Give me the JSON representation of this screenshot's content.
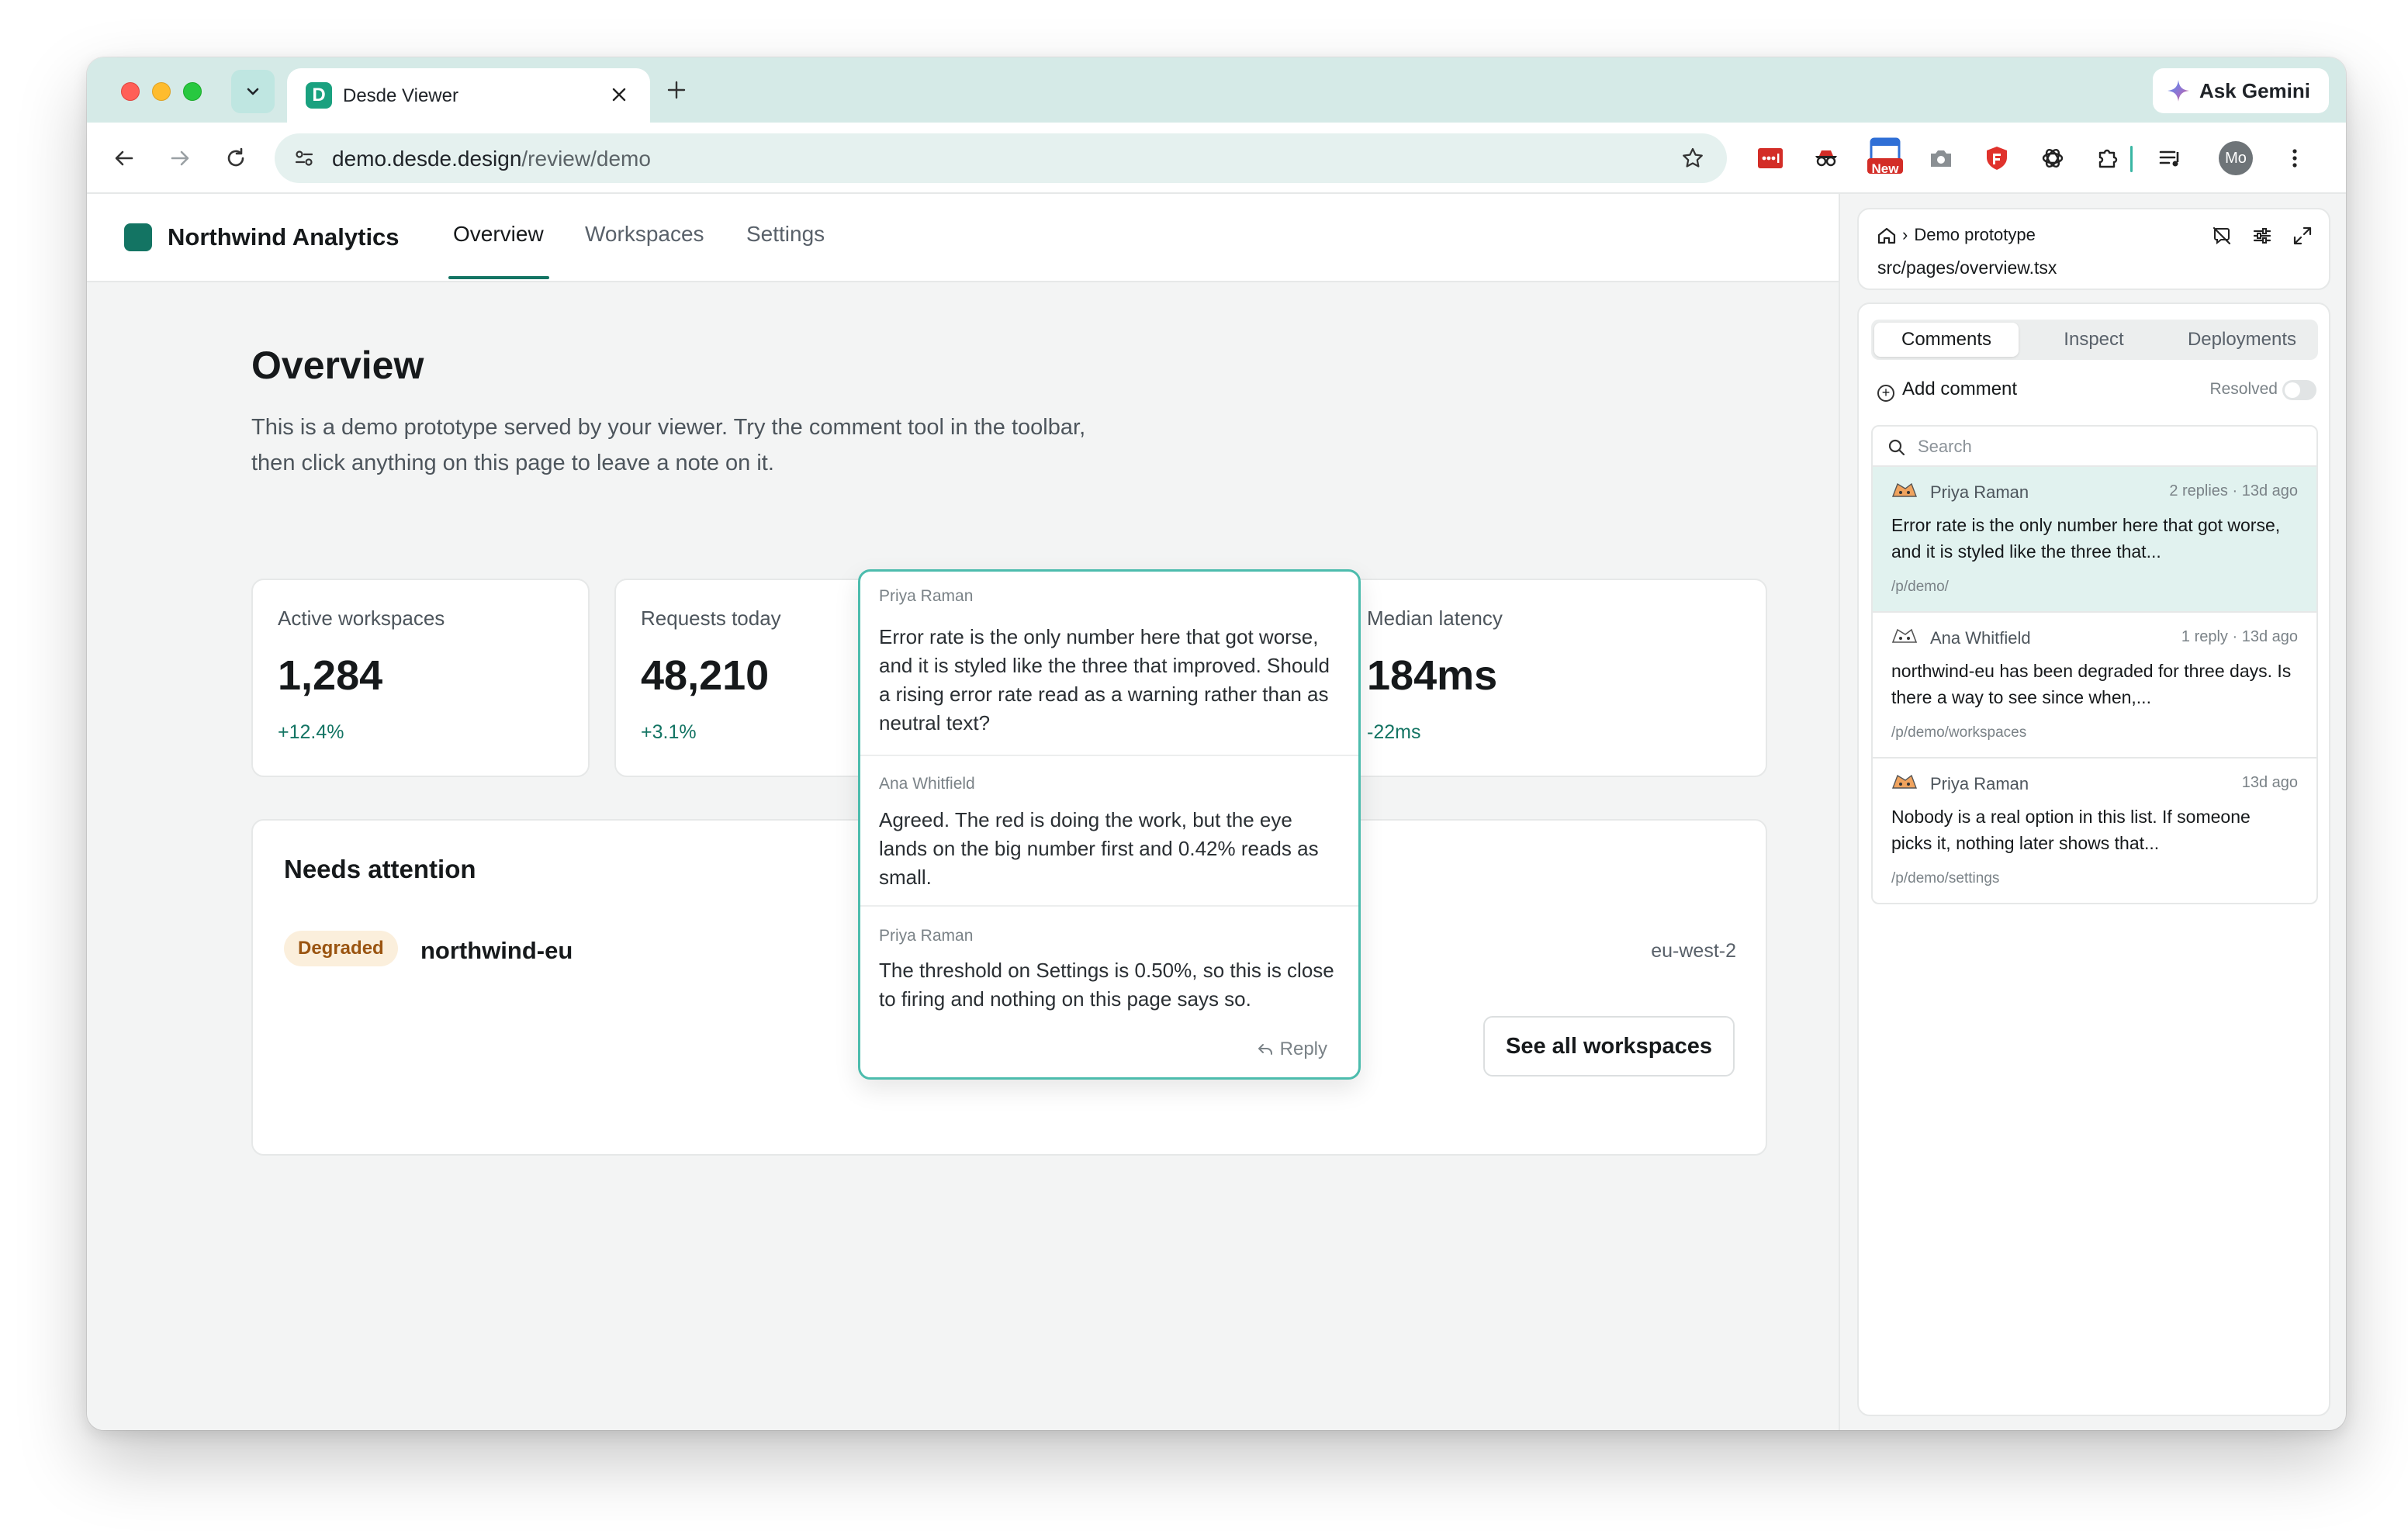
{
  "browser": {
    "tab_title": "Desde Viewer",
    "tab_favicon_letter": "D",
    "ask_gemini": "Ask Gemini",
    "url_host": "demo.desde.design",
    "url_path": "/review/demo",
    "ext_new_badge": "New",
    "profile_initials": "Mo"
  },
  "app": {
    "brand": "Northwind Analytics",
    "nav": [
      "Overview",
      "Workspaces",
      "Settings"
    ],
    "active_nav": "Overview"
  },
  "overview": {
    "title": "Overview",
    "lede": "This is a demo prototype served by your viewer. Try the comment tool in the toolbar, then click anything on this page to leave a note on it.",
    "stats": [
      {
        "label": "Active workspaces",
        "value": "1,284",
        "delta": "+12.4%"
      },
      {
        "label": "Requests today",
        "value": "48,210",
        "delta": "+3.1%"
      },
      {
        "label": "Median latency",
        "value": "184ms",
        "delta": "-22ms"
      }
    ],
    "attention": {
      "title": "Needs attention",
      "badge": "Degraded",
      "workspace": "northwind-eu",
      "region": "eu-west-2",
      "button": "See all workspaces"
    }
  },
  "popover": {
    "messages": [
      {
        "author": "Priya Raman",
        "body": "Error rate is the only number here that got worse, and it is styled like the three that improved. Should a rising error rate read as a warning rather than as neutral text?"
      },
      {
        "author": "Ana Whitfield",
        "body": "Agreed. The red is doing the work, but the eye lands on the big number first and 0.42% reads as small."
      },
      {
        "author": "Priya Raman",
        "body": "The threshold on Settings is 0.50%, so this is close to firing and nothing on this page says so."
      }
    ],
    "reply": "Reply"
  },
  "panel": {
    "breadcrumb": "Demo prototype",
    "file": "src/pages/overview.tsx",
    "tabs": [
      "Comments",
      "Inspect",
      "Deployments"
    ],
    "active_tab": "Comments",
    "add_comment": "Add comment",
    "resolved": "Resolved",
    "search_placeholder": "Search",
    "comments": [
      {
        "author": "Priya Raman",
        "meta": "2 replies · 13d ago",
        "body": "Error rate is the only number here that got worse, and it is styled like the three that...",
        "path": "/p/demo/",
        "selected": true
      },
      {
        "author": "Ana Whitfield",
        "meta": "1 reply · 13d ago",
        "body": "northwind-eu has been degraded for three days. Is there a way to see since when,...",
        "path": "/p/demo/workspaces",
        "selected": false
      },
      {
        "author": "Priya Raman",
        "meta": "13d ago",
        "body": "Nobody is a real option in this list. If someone picks it, nothing later shows that...",
        "path": "/p/demo/settings",
        "selected": false
      }
    ]
  },
  "colors": {
    "accent": "#137463",
    "popover_border": "#4cbcad",
    "tabstrip": "#d5eae7",
    "degraded_bg": "#fbefdc",
    "degraded_text": "#9a5410"
  }
}
